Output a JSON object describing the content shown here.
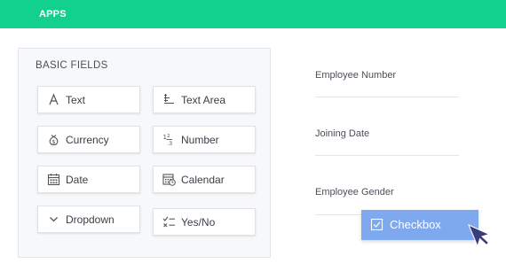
{
  "header": {
    "title": "APPS"
  },
  "panel": {
    "title": "BASIC FIELDS",
    "fields": [
      {
        "label": "Text",
        "icon": "text-icon"
      },
      {
        "label": "Text Area",
        "icon": "text-area-icon"
      },
      {
        "label": "Currency",
        "icon": "currency-icon"
      },
      {
        "label": "Number",
        "icon": "number-icon"
      },
      {
        "label": "Date",
        "icon": "date-icon"
      },
      {
        "label": "Calendar",
        "icon": "calendar-icon"
      },
      {
        "label": "Dropdown",
        "icon": "chevron-down-icon"
      },
      {
        "label": "Yes/No",
        "icon": "yes-no-icon"
      }
    ]
  },
  "form": {
    "fields": [
      {
        "label": "Employee Number"
      },
      {
        "label": "Joining Date"
      },
      {
        "label": "Employee Gender"
      }
    ]
  },
  "dragging": {
    "label": "Checkbox",
    "icon": "checkbox-icon"
  },
  "colors": {
    "header": "#12d18e",
    "drag_item": "#7ea9ef",
    "cursor": "#3b3a7a"
  }
}
